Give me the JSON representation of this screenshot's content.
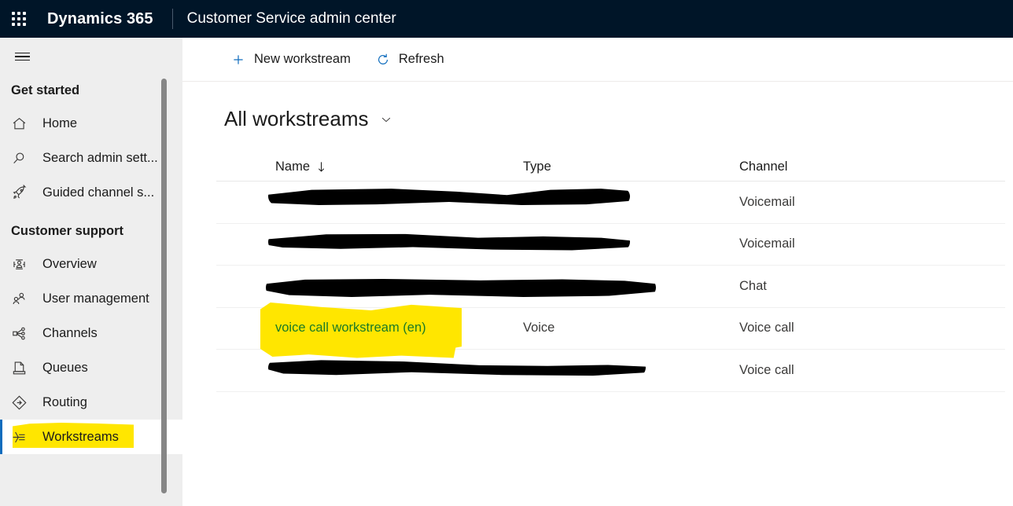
{
  "header": {
    "waffle_icon": "app-launcher-icon",
    "brand": "Dynamics 365",
    "app_name": "Customer Service admin center",
    "background_color": "#001528"
  },
  "sidebar": {
    "menu_icon": "hamburger-icon",
    "background_color": "#eeeeee",
    "selected_accent_color": "#0f6cbd",
    "highlight_color": "#ffe600",
    "groups": [
      {
        "title": "Get started",
        "items": [
          {
            "label": "Home",
            "icon": "home-icon",
            "selected": false
          },
          {
            "label": "Search admin sett...",
            "icon": "search-icon",
            "selected": false
          },
          {
            "label": "Guided channel s...",
            "icon": "rocket-icon",
            "selected": false
          }
        ]
      },
      {
        "title": "Customer support",
        "items": [
          {
            "label": "Overview",
            "icon": "dashboard-icon",
            "selected": false
          },
          {
            "label": "User management",
            "icon": "people-icon",
            "selected": false
          },
          {
            "label": "Channels",
            "icon": "share-nodes-icon",
            "selected": false
          },
          {
            "label": "Queues",
            "icon": "document-icon",
            "selected": false
          },
          {
            "label": "Routing",
            "icon": "routing-diamond-icon",
            "selected": false
          },
          {
            "label": "Workstreams",
            "icon": "workstream-flow-icon",
            "selected": true,
            "highlighted": true
          }
        ]
      }
    ]
  },
  "toolbar": {
    "new_workstream_label": "New workstream",
    "new_workstream_icon": "plus-icon",
    "refresh_label": "Refresh",
    "refresh_icon": "refresh-icon",
    "icon_color": "#0f6cbd"
  },
  "view": {
    "title": "All workstreams",
    "chevron_icon": "chevron-down-icon"
  },
  "grid": {
    "columns": [
      {
        "label": "Name",
        "sorted": true,
        "sort_icon": "sort-descending-arrow"
      },
      {
        "label": "Type",
        "sorted": false
      },
      {
        "label": "Channel",
        "sorted": false
      }
    ],
    "rows": [
      {
        "name": "",
        "type": "",
        "channel": "Voicemail",
        "redacted": true,
        "highlighted": false
      },
      {
        "name": "",
        "type": "",
        "channel": "Voicemail",
        "redacted": true,
        "highlighted": false
      },
      {
        "name": "",
        "type": "",
        "channel": "Chat",
        "redacted": true,
        "highlighted": false
      },
      {
        "name": "voice call workstream (en)",
        "type": "Voice",
        "channel": "Voice call",
        "redacted": false,
        "highlighted": true
      },
      {
        "name": "",
        "type": "",
        "channel": "Voice call",
        "redacted": true,
        "highlighted": false
      }
    ]
  }
}
